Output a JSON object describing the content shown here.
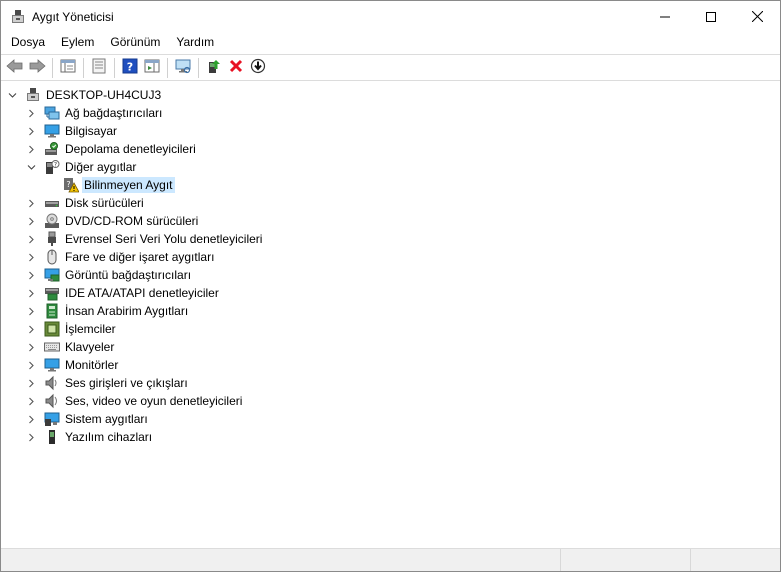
{
  "window": {
    "title": "Aygıt Yöneticisi",
    "controls": [
      "minimize-icon",
      "maximize-icon",
      "close-icon"
    ]
  },
  "menu": [
    "Dosya",
    "Eylem",
    "Görünüm",
    "Yardım"
  ],
  "toolbar": [
    {
      "icon": "back-arrow-icon"
    },
    {
      "icon": "forward-arrow-icon"
    },
    {
      "icon": "show-hide-console-tree-icon"
    },
    {
      "icon": "properties-icon"
    },
    {
      "icon": "help-icon"
    },
    {
      "icon": "action-pane-icon"
    },
    {
      "icon": "scan-hardware-changes-icon"
    },
    {
      "icon": "update-driver-icon"
    },
    {
      "icon": "uninstall-device-icon"
    },
    {
      "icon": "disable-device-icon"
    }
  ],
  "tree": {
    "root": "DESKTOP-UH4CUJ3",
    "items": [
      {
        "label": "Ağ bağdaştırıcıları",
        "icon": "network-adapter-icon",
        "expanded": false
      },
      {
        "label": "Bilgisayar",
        "icon": "computer-icon",
        "expanded": false
      },
      {
        "label": "Depolama denetleyicileri",
        "icon": "storage-controller-icon",
        "expanded": false
      },
      {
        "label": "Diğer aygıtlar",
        "icon": "other-devices-icon",
        "expanded": true,
        "children": [
          {
            "label": "Bilinmeyen Aygıt",
            "icon": "unknown-device-warning-icon",
            "selected": true
          }
        ]
      },
      {
        "label": "Disk sürücüleri",
        "icon": "disk-drive-icon",
        "expanded": false
      },
      {
        "label": "DVD/CD-ROM sürücüleri",
        "icon": "dvd-drive-icon",
        "expanded": false
      },
      {
        "label": "Evrensel Seri Veri Yolu denetleyicileri",
        "icon": "usb-controller-icon",
        "expanded": false
      },
      {
        "label": "Fare ve diğer işaret aygıtları",
        "icon": "mouse-icon",
        "expanded": false
      },
      {
        "label": "Görüntü bağdaştırıcıları",
        "icon": "display-adapter-icon",
        "expanded": false
      },
      {
        "label": "IDE ATA/ATAPI denetleyiciler",
        "icon": "ide-controller-icon",
        "expanded": false
      },
      {
        "label": "İnsan Arabirim Aygıtları",
        "icon": "hid-icon",
        "expanded": false
      },
      {
        "label": "İşlemciler",
        "icon": "processor-icon",
        "expanded": false
      },
      {
        "label": "Klavyeler",
        "icon": "keyboard-icon",
        "expanded": false
      },
      {
        "label": "Monitörler",
        "icon": "monitor-icon",
        "expanded": false
      },
      {
        "label": "Ses girişleri ve çıkışları",
        "icon": "audio-io-icon",
        "expanded": false
      },
      {
        "label": "Ses, video ve oyun denetleyicileri",
        "icon": "sound-video-icon",
        "expanded": false
      },
      {
        "label": "Sistem aygıtları",
        "icon": "system-devices-icon",
        "expanded": false
      },
      {
        "label": "Yazılım cihazları",
        "icon": "software-devices-icon",
        "expanded": false
      }
    ]
  },
  "colors": {
    "selection": "#cce8ff",
    "warning": "#f5c400",
    "delete_red": "#e81123",
    "help_blue": "#1f4fbf"
  }
}
